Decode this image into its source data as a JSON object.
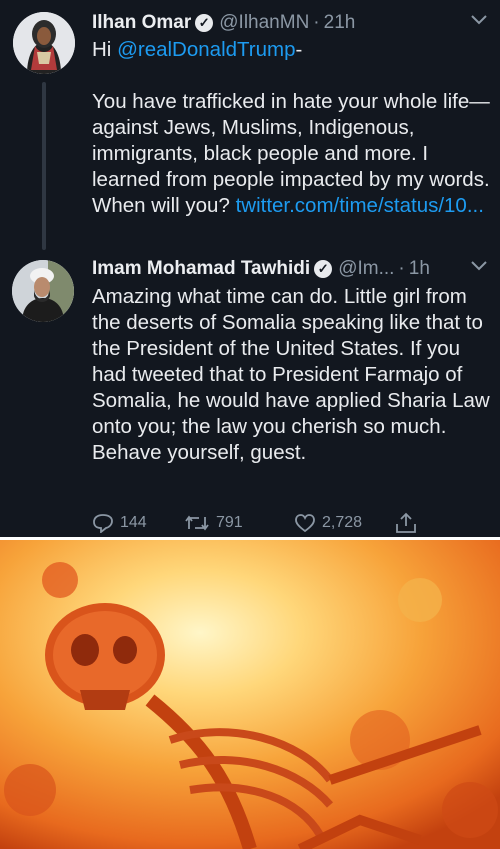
{
  "tweet1": {
    "name": "Ilhan Omar",
    "handle": "@IlhanMN",
    "time": "21h",
    "greeting": "Hi ",
    "mention": "@realDonaldTrump",
    "mention_suffix": "-",
    "body": "You have trafficked in hate your whole life—against Jews, Muslims, Indigenous, immigrants, black people and more. I learned from people impacted by my words. When will you? ",
    "link": "twitter.com/time/status/10..."
  },
  "tweet2": {
    "name": "Imam Mohamad Tawhidi",
    "handle": "@Im...",
    "time": "1h",
    "body": "Amazing what time can do. Little girl from the deserts of Somalia speaking like that to the President of the United States. If you had tweeted that to President Farmajo of Somalia, he would have applied Sharia Law onto you; the law you cherish so much. Behave yourself, guest."
  },
  "actions": {
    "replies": "144",
    "retweets": "791",
    "likes": "2,728"
  },
  "meme_image": "image of a burning skeleton engulfed in orange flames"
}
